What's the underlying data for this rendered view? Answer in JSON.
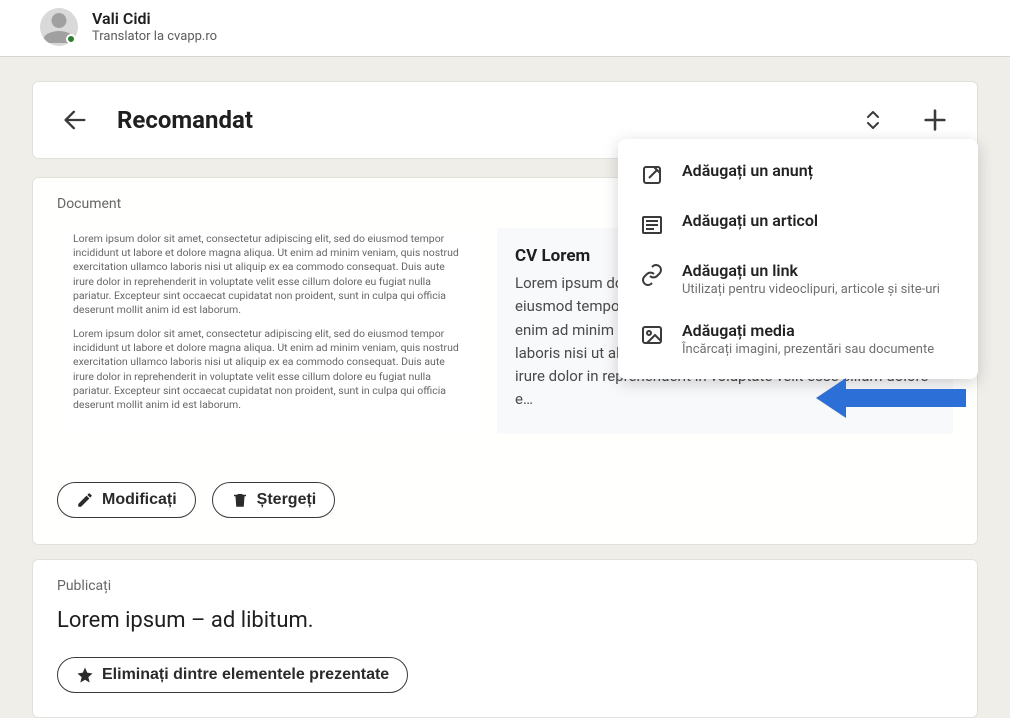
{
  "profile": {
    "name": "Vali Cidi",
    "subtitle": "Translator la cvapp.ro"
  },
  "header": {
    "title": "Recomandat"
  },
  "section": {
    "label": "Document",
    "thumb_para1": "Lorem ipsum dolor sit amet, consectetur adipiscing elit, sed do eiusmod tempor incididunt ut labore et dolore magna aliqua. Ut enim ad minim veniam, quis nostrud exercitation ullamco laboris nisi ut aliquip ex ea commodo consequat. Duis aute irure dolor in reprehenderit in voluptate velit esse cillum dolore eu fugiat nulla pariatur. Excepteur sint occaecat cupidatat non proident, sunt in culpa qui officia deserunt mollit anim id est laborum.",
    "thumb_para2": "Lorem ipsum dolor sit amet, consectetur adipiscing elit, sed do eiusmod tempor incididunt ut labore et dolore magna aliqua. Ut enim ad minim veniam, quis nostrud exercitation ullamco laboris nisi ut aliquip ex ea commodo consequat. Duis aute irure dolor in reprehenderit in voluptate velit esse cillum dolore eu fugiat nulla pariatur. Excepteur sint occaecat cupidatat non proident, sunt in culpa qui officia deserunt mollit anim id est laborum.",
    "doc_title": "CV Lorem",
    "doc_desc": "Lorem ipsum dolor sit amet, consectetur adipiscing elit, sed do eiusmod tempor incididunt ut labore et dolore magna aliqua. Ut enim ad minim veniam, quis nostrud exercitation ullamco laboris nisi ut aliquip ex ea commodo consequat. Duis aute irure dolor in reprehenderit in voluptate velit esse cillum dolore e…"
  },
  "actions": {
    "modify": "Modificați",
    "delete": "Ștergeți",
    "remove_featured": "Eliminați dintre elementele prezentate"
  },
  "publish": {
    "label": "Publicați",
    "text": "Lorem ipsum – ad libitum."
  },
  "dropdown": {
    "items": [
      {
        "title": "Adăugați un anunț",
        "sub": ""
      },
      {
        "title": "Adăugați un articol",
        "sub": ""
      },
      {
        "title": "Adăugați un link",
        "sub": "Utilizați pentru videoclipuri, articole și site-uri"
      },
      {
        "title": "Adăugați media",
        "sub": "Încărcați imagini, prezentări sau documente"
      }
    ]
  }
}
